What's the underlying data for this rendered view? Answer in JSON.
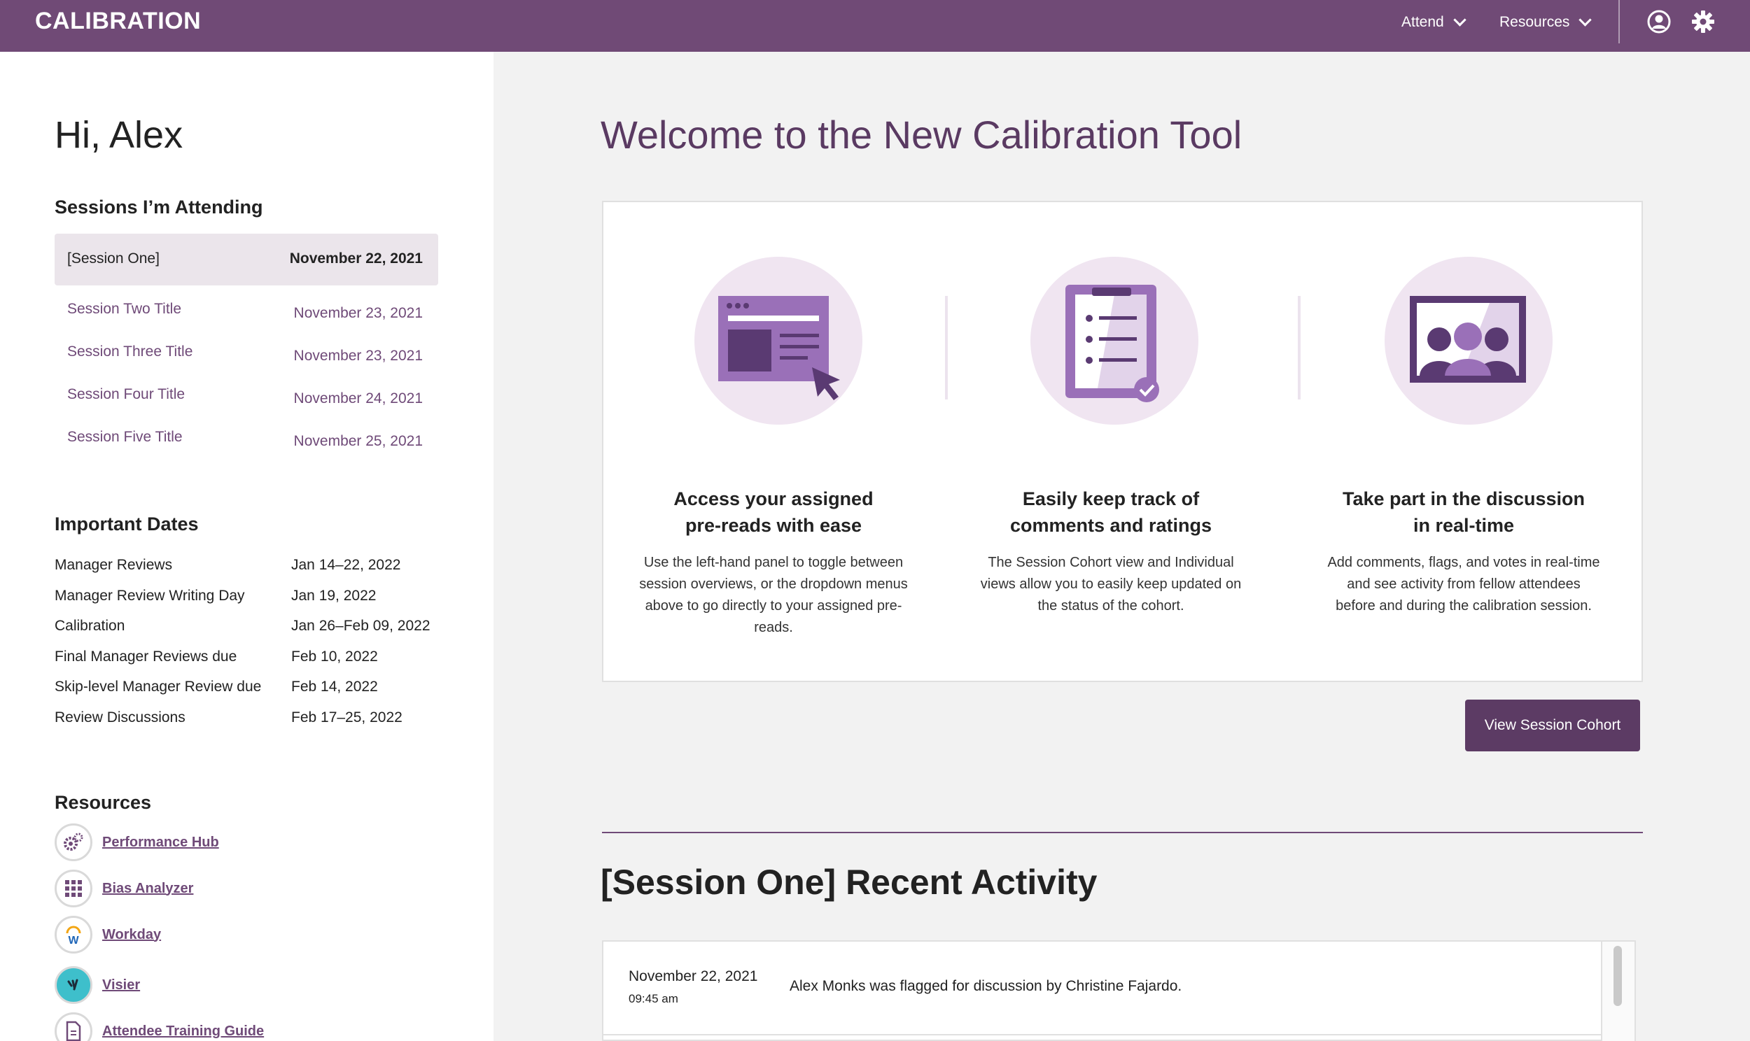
{
  "header": {
    "logo": "CALIBRATION",
    "nav": [
      {
        "label": "Attend"
      },
      {
        "label": "Resources"
      }
    ]
  },
  "sidebar": {
    "greeting": "Hi, Alex",
    "sessions_heading": "Sessions I’m Attending",
    "sessions": [
      {
        "title": "[Session One]",
        "date": "November 22, 2021"
      },
      {
        "title": "Session Two Title",
        "date": "November 23, 2021"
      },
      {
        "title": "Session Three Title",
        "date": "November 23, 2021"
      },
      {
        "title": "Session Four Title",
        "date": "November 24, 2021"
      },
      {
        "title": "Session Five Title",
        "date": "November 25, 2021"
      }
    ],
    "dates_heading": "Important Dates",
    "dates": [
      {
        "label": "Manager Reviews",
        "value": "Jan 14–22, 2022"
      },
      {
        "label": "Manager Review Writing Day",
        "value": "Jan 19, 2022"
      },
      {
        "label": "Calibration",
        "value": "Jan 26–Feb 09, 2022"
      },
      {
        "label": "Final Manager Reviews due",
        "value": "Feb 10, 2022"
      },
      {
        "label": "Skip-level Manager Review due",
        "value": "Feb 14, 2022"
      },
      {
        "label": "Review Discussions",
        "value": "Feb 17–25, 2022"
      }
    ],
    "resources_heading": "Resources",
    "resources": [
      {
        "label": "Performance Hub",
        "icon": "gears-icon"
      },
      {
        "label": "Bias Analyzer",
        "icon": "grid-icon"
      },
      {
        "label": "Workday",
        "icon": "workday-icon"
      },
      {
        "label": "Visier",
        "icon": "visier-icon"
      },
      {
        "label": "Attendee Training Guide",
        "icon": "document-icon"
      }
    ]
  },
  "main": {
    "title": "Welcome to the New Calibration Tool",
    "features": [
      {
        "title_line1": "Access your assigned",
        "title_line2": "pre-reads with ease",
        "desc": "Use the left-hand panel to toggle between session overviews, or the dropdown menus above to go directly to your assigned pre-reads.",
        "icon": "browser-cursor-icon"
      },
      {
        "title_line1": "Easily keep track of",
        "title_line2": "comments and ratings",
        "desc": "The Session Cohort view and Individual views allow you to easily keep updated on the status of the cohort.",
        "icon": "clipboard-checklist-icon"
      },
      {
        "title_line1": "Take part in the discussion",
        "title_line2": "in real-time",
        "desc": "Add comments, flags, and votes in real-time and see activity from fellow attendees before and during the calibration session.",
        "icon": "video-meeting-icon"
      }
    ],
    "view_button": "View Session Cohort",
    "activity_title": "[Session One] Recent Activity",
    "activity": [
      {
        "date": "November 22, 2021",
        "time": "09:45 am",
        "text": "Alex Monks was flagged for discussion by Christine Fajardo."
      }
    ]
  },
  "colors": {
    "brand": "#704a76",
    "brand_dark": "#5c3b64",
    "accent_light": "#f0e5f1"
  }
}
